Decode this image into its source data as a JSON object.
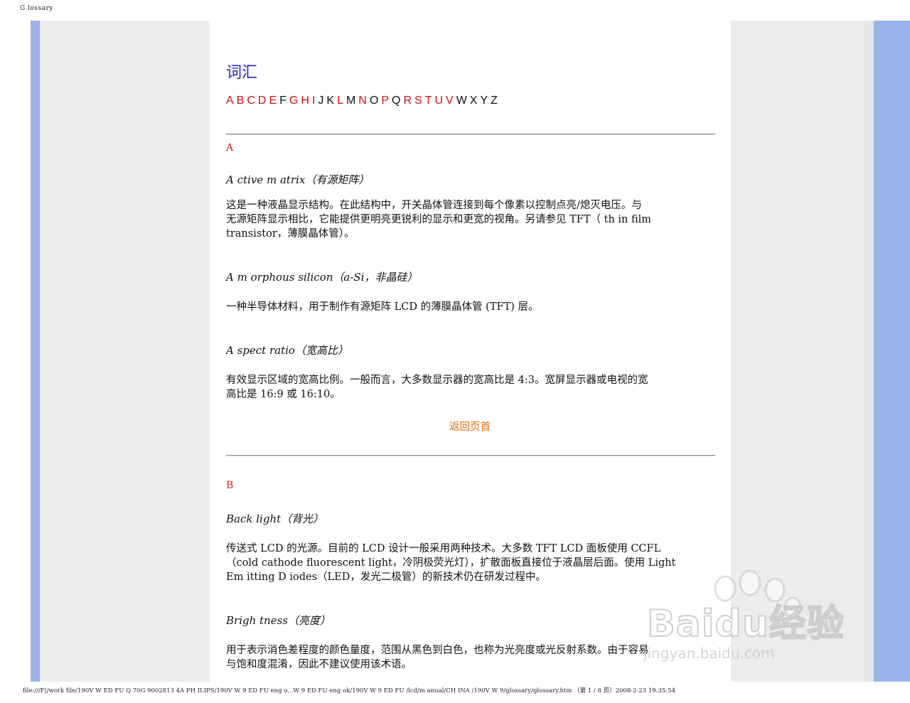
{
  "tab_title": "G lossary",
  "page_title": "词汇",
  "alphabet": [
    {
      "letter": "A",
      "linked": true
    },
    {
      "letter": "B",
      "linked": true
    },
    {
      "letter": "C",
      "linked": true
    },
    {
      "letter": "D",
      "linked": true
    },
    {
      "letter": "E",
      "linked": true
    },
    {
      "letter": "F",
      "linked": false
    },
    {
      "letter": "G",
      "linked": true
    },
    {
      "letter": "H",
      "linked": true
    },
    {
      "letter": "I",
      "linked": true
    },
    {
      "letter": "J",
      "linked": false
    },
    {
      "letter": "K",
      "linked": false
    },
    {
      "letter": "L",
      "linked": true
    },
    {
      "letter": "M",
      "linked": false
    },
    {
      "letter": "N",
      "linked": true
    },
    {
      "letter": "O",
      "linked": false
    },
    {
      "letter": "P",
      "linked": true
    },
    {
      "letter": "Q",
      "linked": false
    },
    {
      "letter": "R",
      "linked": true
    },
    {
      "letter": "S",
      "linked": true
    },
    {
      "letter": "T",
      "linked": true
    },
    {
      "letter": "U",
      "linked": true
    },
    {
      "letter": "V",
      "linked": true
    },
    {
      "letter": "W",
      "linked": false
    },
    {
      "letter": "X",
      "linked": false
    },
    {
      "letter": "Y",
      "linked": false
    },
    {
      "letter": "Z",
      "linked": false
    }
  ],
  "colors": {
    "link": "#cc1111",
    "title": "#2323c8",
    "back_to_top": "#e06a10",
    "side_bar": "#99b3ea"
  },
  "sections": {
    "a": {
      "letter": "A",
      "terms": [
        {
          "term": "A ctive m atrix（有源矩阵）",
          "lines": [
            "这是一种液晶显示结构。在此结构中，开关晶体管连接到每个像素以控制点亮/熄灭电压。与",
            "无源矩阵显示相比，它能提供更明亮更锐利的显示和更宽的视角。另请参见 TFT（ th in film",
            "transistor，薄膜晶体管）。"
          ]
        },
        {
          "term": "A m orphous silicon（a-Si，非晶硅）",
          "lines": [
            "一种半导体材料，用于制作有源矩阵 LCD 的薄膜晶体管 (TFT) 层。"
          ]
        },
        {
          "term": "A spect ratio（宽高比）",
          "lines": [
            "有效显示区域的宽高比例。一般而言，大多数显示器的宽高比是 4:3。宽屏显示器或电视的宽",
            "高比是 16:9 或 16:10。"
          ]
        }
      ]
    },
    "back_to_top": "返回页首",
    "b": {
      "letter": "B",
      "terms": [
        {
          "term": "Back light（背光）",
          "lines": [
            "传送式 LCD 的光源。目前的 LCD 设计一般采用两种技术。大多数 TFT LCD 面板使用 CCFL",
            "（cold cathode fluorescent light，冷阴极荧光灯），扩散面板直接位于液晶层后面。使用 Light",
            "Em itting D iodes（LED，发光二极管）的新技术仍在研发过程中。"
          ]
        },
        {
          "term": "Brigh tness（亮度）",
          "lines": [
            "用于表示消色差程度的颜色量度，范围从黑色到白色，也称为光亮度或光反射系数。由于容易",
            "与饱和度混淆，因此不建议使用该术语。"
          ]
        }
      ]
    }
  },
  "footer": "file:///F|/work file/190V W  ED FU Q 70G 9002813 4A PH ILIPS/190V W  9 ED FU  eng o...W  9 ED FU  eng ok/190V W  9 ED FU /lcd/m anual/CH INA /190V W  9/glossary/glossary.htm （第 1 / 8 页）2008-2-23 19:35:54",
  "watermark": {
    "brand": "Baidu经验",
    "url": "jingyan.baidu.com"
  }
}
